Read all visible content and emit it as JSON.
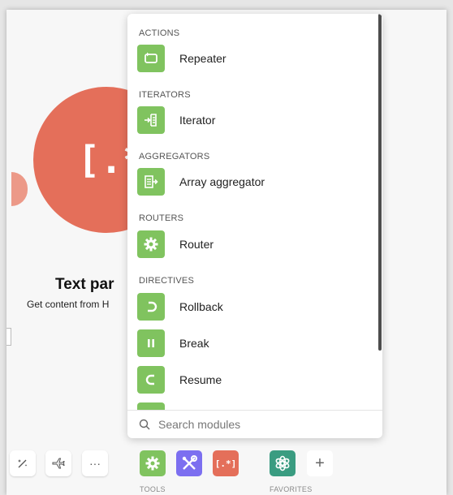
{
  "module": {
    "glyph": "[.*]",
    "title": "Text par",
    "subtitle": "Get content from H"
  },
  "panel": {
    "sections": [
      {
        "label": "ACTIONS",
        "items": [
          {
            "label": "Repeater",
            "icon": "repeater-icon"
          }
        ]
      },
      {
        "label": "ITERATORS",
        "items": [
          {
            "label": "Iterator",
            "icon": "iterator-icon"
          }
        ]
      },
      {
        "label": "AGGREGATORS",
        "items": [
          {
            "label": "Array aggregator",
            "icon": "array-aggregator-icon"
          }
        ]
      },
      {
        "label": "ROUTERS",
        "items": [
          {
            "label": "Router",
            "icon": "router-gear-icon"
          }
        ]
      },
      {
        "label": "DIRECTIVES",
        "items": [
          {
            "label": "Rollback",
            "icon": "rollback-icon"
          },
          {
            "label": "Break",
            "icon": "pause-icon"
          },
          {
            "label": "Resume",
            "icon": "resume-icon"
          }
        ]
      }
    ],
    "search_placeholder": "Search modules"
  },
  "toolbar": {
    "more_glyph": "···",
    "plus_glyph": "+",
    "tools_label": "TOOLS",
    "favorites_label": "FAVORITES",
    "text_parser_glyph": "[.*]"
  },
  "colors": {
    "module_red": "#e46f5a",
    "tool_green": "#80c35f",
    "flow_control_purple": "#7c6ff0",
    "openai_green": "#3a9c81"
  }
}
